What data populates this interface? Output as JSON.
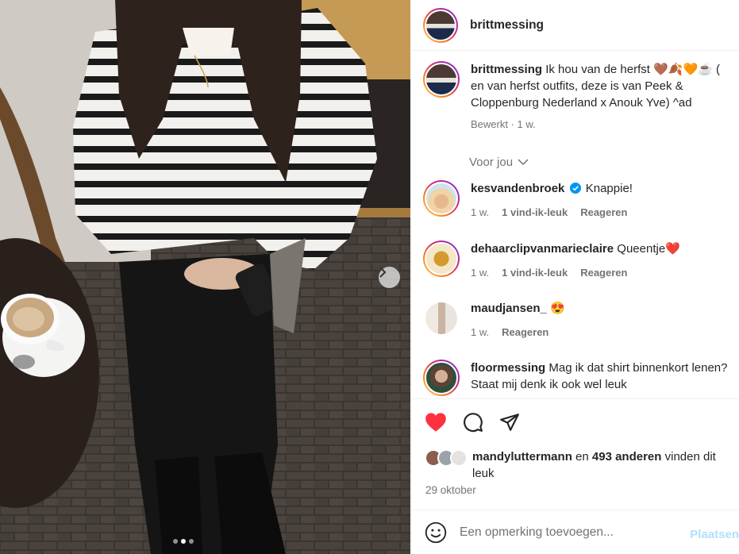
{
  "post": {
    "author": "brittmessing",
    "caption": {
      "username": "brittmessing",
      "text": "Ik hou van de herfst 🤎🍂🧡☕ ( en van herfst outfits, deze is van Peek & Cloppenburg Nederland x Anouk Yve) ^ad",
      "meta": "Bewerkt · 1 w."
    },
    "voor_jou": "Voor jou",
    "comments": [
      {
        "username": "kesvandenbroek",
        "text": "Knappie!",
        "verified": true,
        "time": "1 w.",
        "likes": "1 vind-ik-leuk",
        "reply": "Reageren"
      },
      {
        "username": "dehaarclipvanmarieclaire",
        "text": "Queentje❤️",
        "verified": false,
        "time": "1 w.",
        "likes": "1 vind-ik-leuk",
        "reply": "Reageren"
      },
      {
        "username": "maudjansen_",
        "text": "😍",
        "verified": false,
        "time": "1 w.",
        "likes": "",
        "reply": "Reageren"
      },
      {
        "username": "floormessing",
        "text": "Mag ik dat shirt binnenkort lenen? Staat mij denk ik ook wel leuk",
        "verified": false,
        "time": "",
        "likes": "",
        "reply": ""
      }
    ],
    "liked_by": {
      "first": "mandyluttermann",
      "connector": "en",
      "others": "493 anderen",
      "suffix": "vinden dit leuk"
    },
    "date": "29 oktober",
    "add_comment_placeholder": "Een opmerking toevoegen...",
    "post_button": "Plaatsen",
    "carousel": {
      "total": 3,
      "active": 1
    }
  },
  "icons": {
    "like": "heart-filled-icon",
    "comment": "comment-bubble-icon",
    "share": "paper-plane-icon",
    "emoji": "emoji-icon",
    "next": "chevron-right-icon",
    "verified": "verified-badge-icon"
  },
  "colors": {
    "like": "#ff3040",
    "verified": "#0095f6",
    "post_button": "#b2dffc"
  }
}
